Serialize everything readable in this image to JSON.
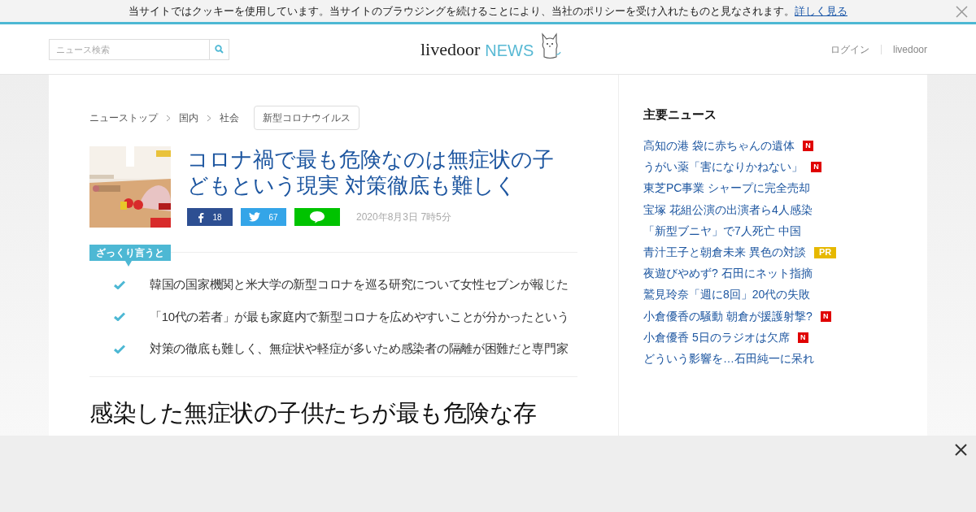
{
  "cookie_bar": {
    "message": "当サイトではクッキーを使用しています。当サイトのブラウジングを続けることにより、当社のポリシーを受け入れたものと見なされます。",
    "link": "詳しく見る"
  },
  "header": {
    "search": {
      "placeholder": "ニュース検索"
    },
    "logo": {
      "name": "livedoor",
      "service": "NEWS"
    },
    "nav": [
      "ログイン",
      "livedoor"
    ]
  },
  "article": {
    "breadcrumbs": [
      "ニューストップ",
      "国内",
      "社会"
    ],
    "tag": "新型コロナウイルス",
    "title": "コロナ禍で最も危険なのは無症状の子どもという現実 対策徹底も難しく",
    "shares": [
      {
        "kind": "facebook",
        "count": "18"
      },
      {
        "kind": "twitter",
        "count": "67"
      },
      {
        "kind": "line"
      }
    ],
    "date": "2020年8月3日 7時5分",
    "summary": {
      "label": "ざっくり言うと",
      "points": [
        "韓国の国家機関と米大学の新型コロナを巡る研究について女性セブンが報じた",
        "「10代の若者」が最も家庭内で新型コロナを広めやすいことが分かったという",
        "対策の徹底も難しく、無症状や軽症が多いため感染者の隔離が困難だと専門家"
      ]
    },
    "heading": "感染した無症状の子供たちが最も危険な存"
  },
  "sidebar": {
    "title": "主要ニュース",
    "items": [
      {
        "text": "高知の港 袋に赤ちゃんの遺体",
        "badge": {
          "kind": "new",
          "text": "N"
        }
      },
      {
        "text": "うがい薬「害になりかねない」",
        "badge": {
          "kind": "new",
          "text": "N"
        }
      },
      {
        "text": "東芝PC事業 シャープに完全売却"
      },
      {
        "text": "宝塚 花組公演の出演者ら4人感染"
      },
      {
        "text": "「新型ブニヤ」で7人死亡 中国"
      },
      {
        "text": "青汁王子と朝倉未来 異色の対談",
        "badge": {
          "kind": "pr",
          "text": "PR"
        }
      },
      {
        "text": "夜遊びやめず? 石田にネット指摘"
      },
      {
        "text": "鷲見玲奈「週に8回」20代の失敗"
      },
      {
        "text": "小倉優香の騒動 朝倉が援護射撃?",
        "badge": {
          "kind": "new",
          "text": "N"
        }
      },
      {
        "text": "小倉優香 5日のラジオは欠席",
        "badge": {
          "kind": "new",
          "text": "N"
        }
      },
      {
        "text": "どういう影響を…石田純一に呆れ"
      }
    ]
  }
}
